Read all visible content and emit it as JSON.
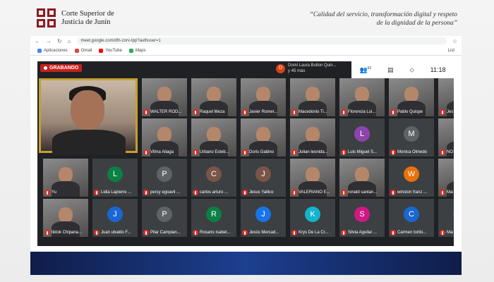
{
  "header": {
    "logo_line1": "Corte Superior de",
    "logo_line2": "Justicia de Junín",
    "slogan": "“Calidad del servicio, transformación digital y respeto de la dignidad de la persona”"
  },
  "browser": {
    "url": "meet.google.com/dfn-zorv-tpp?authuser=1",
    "bookmarks": [
      "Aplicaciones",
      "Gmail",
      "YouTube",
      "Maps"
    ],
    "bookmark_colors": [
      "#4285f4",
      "#ea4335",
      "#ff0000",
      "#34a853"
    ],
    "list_label": "List"
  },
  "meet": {
    "recording_label": "GRABANDO",
    "notification_initial": "D",
    "notification_line1": "Domi Laura Bullon Quin...",
    "notification_line2": "y 45 más",
    "participants_count": "62",
    "time": "11:18"
  },
  "tiles": [
    {
      "name": "WALTER ROD...",
      "type": "video"
    },
    {
      "name": "Raquel Meza",
      "type": "video"
    },
    {
      "name": "Javier Romer...",
      "type": "video"
    },
    {
      "name": "Macedonio Ti...",
      "type": "video"
    },
    {
      "name": "Florencia Lui...",
      "type": "video"
    },
    {
      "name": "Pablo Quispe",
      "type": "video"
    },
    {
      "name": "Jesú",
      "type": "video"
    },
    {
      "name": "Vilma Aliaga",
      "type": "video"
    },
    {
      "name": "Urbano Esteb...",
      "type": "video"
    },
    {
      "name": "Doris Gabino",
      "type": "video"
    },
    {
      "name": "Julian leonida...",
      "type": "video"
    },
    {
      "name": "Luis Miguel S...",
      "type": "avatar",
      "initial": "L",
      "color": "#8e44ad"
    },
    {
      "name": "Monica Olmedo",
      "type": "avatar",
      "initial": "M",
      "color": "#5f6368"
    },
    {
      "name": "NOR",
      "type": "video"
    },
    {
      "name": "Yu",
      "type": "video"
    },
    {
      "name": "Lidia Lapierre ...",
      "type": "avatar",
      "initial": "L",
      "color": "#0b8043"
    },
    {
      "name": "percy egoavil ...",
      "type": "avatar",
      "initial": "P",
      "color": "#5f6368"
    },
    {
      "name": "carlos arturo ...",
      "type": "avatar",
      "initial": "C",
      "color": "#795548"
    },
    {
      "name": "Jesus Yallico",
      "type": "avatar",
      "initial": "J",
      "color": "#795548"
    },
    {
      "name": "VALERIANO E...",
      "type": "video"
    },
    {
      "name": "ronald santan...",
      "type": "video"
    },
    {
      "name": "winston franz ...",
      "type": "avatar",
      "initial": "W",
      "color": "#e8710a"
    },
    {
      "name": "Mari",
      "type": "video"
    },
    {
      "name": "tiktok Chipana...",
      "type": "video"
    },
    {
      "name": "Juan ubaldo F...",
      "type": "avatar",
      "initial": "J",
      "color": "#1967d2"
    },
    {
      "name": "Pilar Campian...",
      "type": "avatar",
      "initial": "P",
      "color": "#5f6368"
    },
    {
      "name": "Rosario Isabel...",
      "type": "avatar",
      "initial": "R",
      "color": "#0b8043"
    },
    {
      "name": "Jesús Mercad...",
      "type": "avatar",
      "initial": "J",
      "color": "#1a73e8"
    },
    {
      "name": "Krys De La Cr...",
      "type": "avatar",
      "initial": "K",
      "color": "#12b5cb"
    },
    {
      "name": "Silvia Aguilar ...",
      "type": "avatar",
      "initial": "S",
      "color": "#d01884"
    },
    {
      "name": "Carmen toribi...",
      "type": "avatar",
      "initial": "C",
      "color": "#1967d2"
    },
    {
      "name": "Mari",
      "type": "avatar",
      "initial": "M",
      "color": "#8e24aa"
    }
  ]
}
